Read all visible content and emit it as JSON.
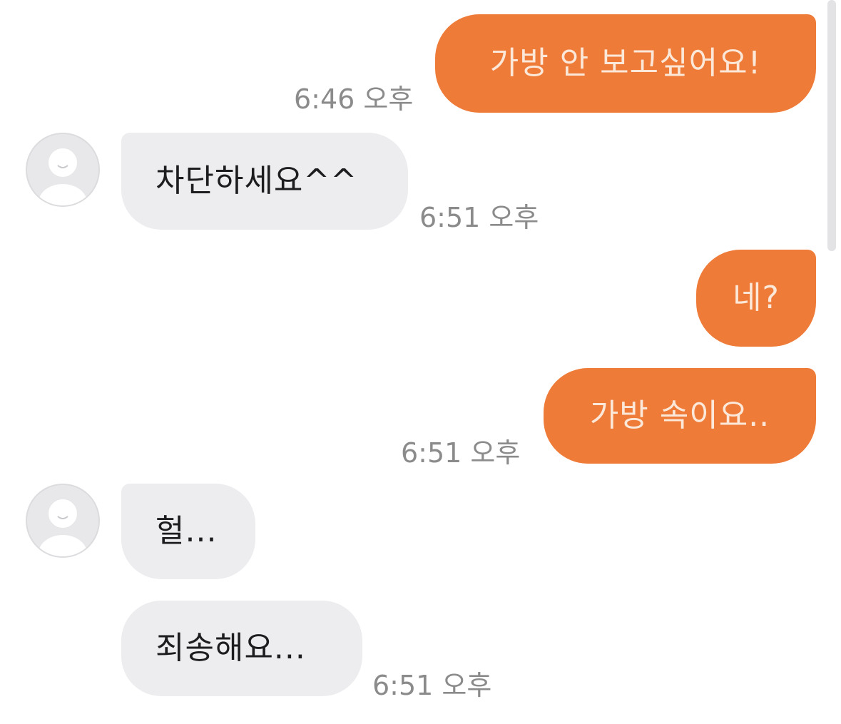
{
  "messages": [
    {
      "side": "out",
      "text": "가방 안 보고싶어요!",
      "time": "6:46 오후"
    },
    {
      "side": "in",
      "text": "차단하세요^^",
      "time": "6:51 오후"
    },
    {
      "side": "out",
      "text": "네?",
      "time": ""
    },
    {
      "side": "out",
      "text": "가방 속이요..",
      "time": "6:51 오후"
    },
    {
      "side": "in",
      "text": "헐...",
      "time": ""
    },
    {
      "side": "in",
      "text": "죄송해요...",
      "time": "6:51 오후"
    }
  ],
  "colors": {
    "outgoing_bubble": "#ef7b39",
    "outgoing_text": "#fbe8d8",
    "incoming_bubble": "#ededf0",
    "incoming_text": "#1d1d1f",
    "timestamp": "#8b8b8b"
  },
  "icons": {
    "avatar": "default-profile-avatar-icon"
  }
}
